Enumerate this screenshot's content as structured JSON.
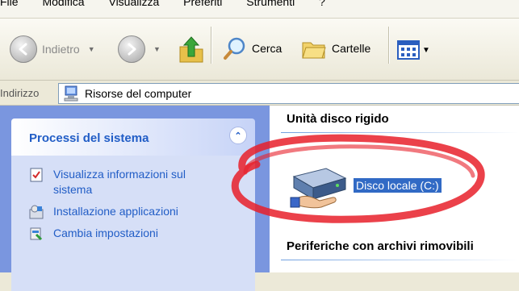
{
  "menubar": {
    "items": [
      "File",
      "Modifica",
      "Visualizza",
      "Preferiti",
      "Strumenti",
      "?"
    ]
  },
  "toolbar": {
    "back_label": "Indietro",
    "search_label": "Cerca",
    "folders_label": "Cartelle"
  },
  "address": {
    "label": "Indirizzo",
    "value": "Risorse del computer"
  },
  "sidebar": {
    "title": "Processi del sistema",
    "collapse_glyph": "⌃",
    "tasks": [
      {
        "label": "Visualizza informazioni sul sistema"
      },
      {
        "label": "Installazione applicazioni"
      },
      {
        "label": "Cambia impostazioni"
      }
    ]
  },
  "content": {
    "group_hard_disks": "Unità disco rigido",
    "drive_label": "Disco locale (C:)",
    "group_removable": "Periferiche con archivi rimovibili"
  },
  "colors": {
    "task_link": "#215dc6",
    "selection": "#316ac5",
    "annotation": "#e8202a"
  },
  "icons": [
    "back-arrow-icon",
    "forward-arrow-icon",
    "up-folder-icon",
    "search-icon",
    "folders-icon",
    "views-icon",
    "computer-icon",
    "system-info-icon",
    "add-remove-programs-icon",
    "control-panel-icon",
    "hard-drive-icon"
  ]
}
